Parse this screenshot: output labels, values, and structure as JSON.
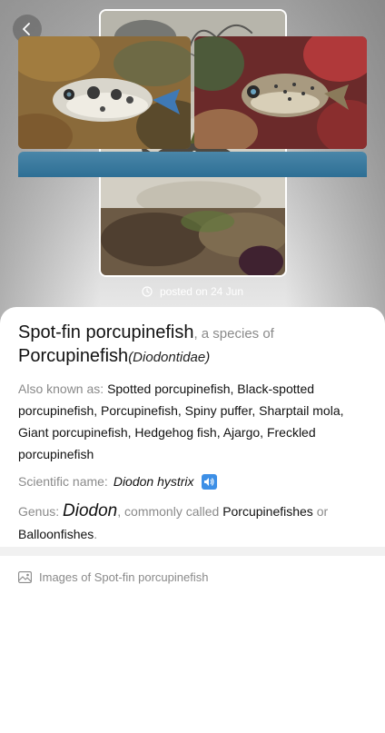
{
  "header": {
    "back_icon": "chevron-left-icon",
    "posted_icon": "clock-icon",
    "posted_text": "posted on 24 Jun"
  },
  "species": {
    "common_name": "Spot-fin porcupinefish",
    "species_of_text": ", a species of",
    "family_common": "Porcupinefish",
    "family_scientific": "(Diodontidae)"
  },
  "aka": {
    "label": "Also known as: ",
    "names": "Spotted porcupinefish, Black-spotted porcupinefish, Porcupinefish, Spiny puffer, Sharptail mola, Giant porcupinefish, Hedgehog fish, Ajargo, Freckled porcupinefish"
  },
  "scientific": {
    "label": "Scientific name: ",
    "name": "Diodon hystrix",
    "speaker_icon": "speaker-icon"
  },
  "genus": {
    "label": "Genus: ",
    "name": "Diodon",
    "commonly_text": ", commonly called ",
    "common1": "Porcupinefishes",
    "or_text": " or ",
    "common2": "Balloonfishes",
    "end": "."
  },
  "gallery": {
    "icon": "image-icon",
    "title": "Images of Spot-fin porcupinefish"
  },
  "colors": {
    "accent": "#3d8fe6",
    "muted_text": "#8a8a8a"
  }
}
